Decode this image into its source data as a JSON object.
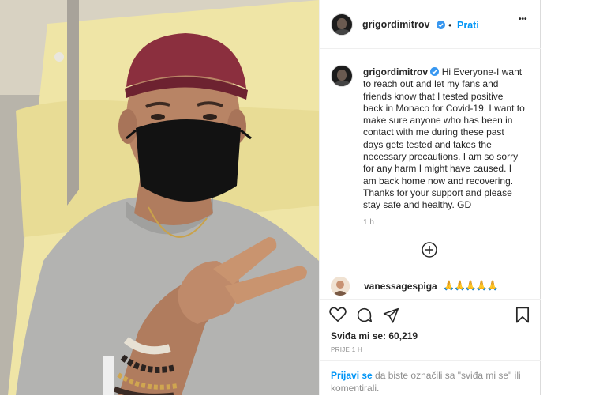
{
  "post": {
    "username": "grigordimitrov",
    "separator": "•",
    "follow_label": "Prati",
    "more_label": "•••",
    "caption_text": "Hi Everyone-I want to reach out and let my fans and friends know that I tested positive back in Monaco for Covid-19. I want to make sure anyone who has been in contact with me during these past days gets tested and takes the necessary precautions. I am so sorry for any harm I might have caused. I am back home now and recovering. Thanks for your support and please stay safe and healthy. GD",
    "caption_time": "1 h",
    "comment": {
      "username": "vanessagespiga",
      "text": "🙏🙏🙏🙏🙏"
    },
    "likes_label": "Sviđa mi se:",
    "likes_count": "60,219",
    "posted_ago": "PRIJE 1 H",
    "login_link": "Prijavi se",
    "login_rest": " da biste označili sa \"sviđa mi se\" ili komentirali."
  },
  "icons": [
    "heart-icon",
    "comment-icon",
    "share-icon",
    "bookmark-icon",
    "add-comment-icon",
    "verified-icon",
    "more-options-icon"
  ],
  "colors": {
    "accent": "#0095f6",
    "verified": "#3897f0",
    "text": "#262626",
    "muted": "#8e8e8e"
  }
}
